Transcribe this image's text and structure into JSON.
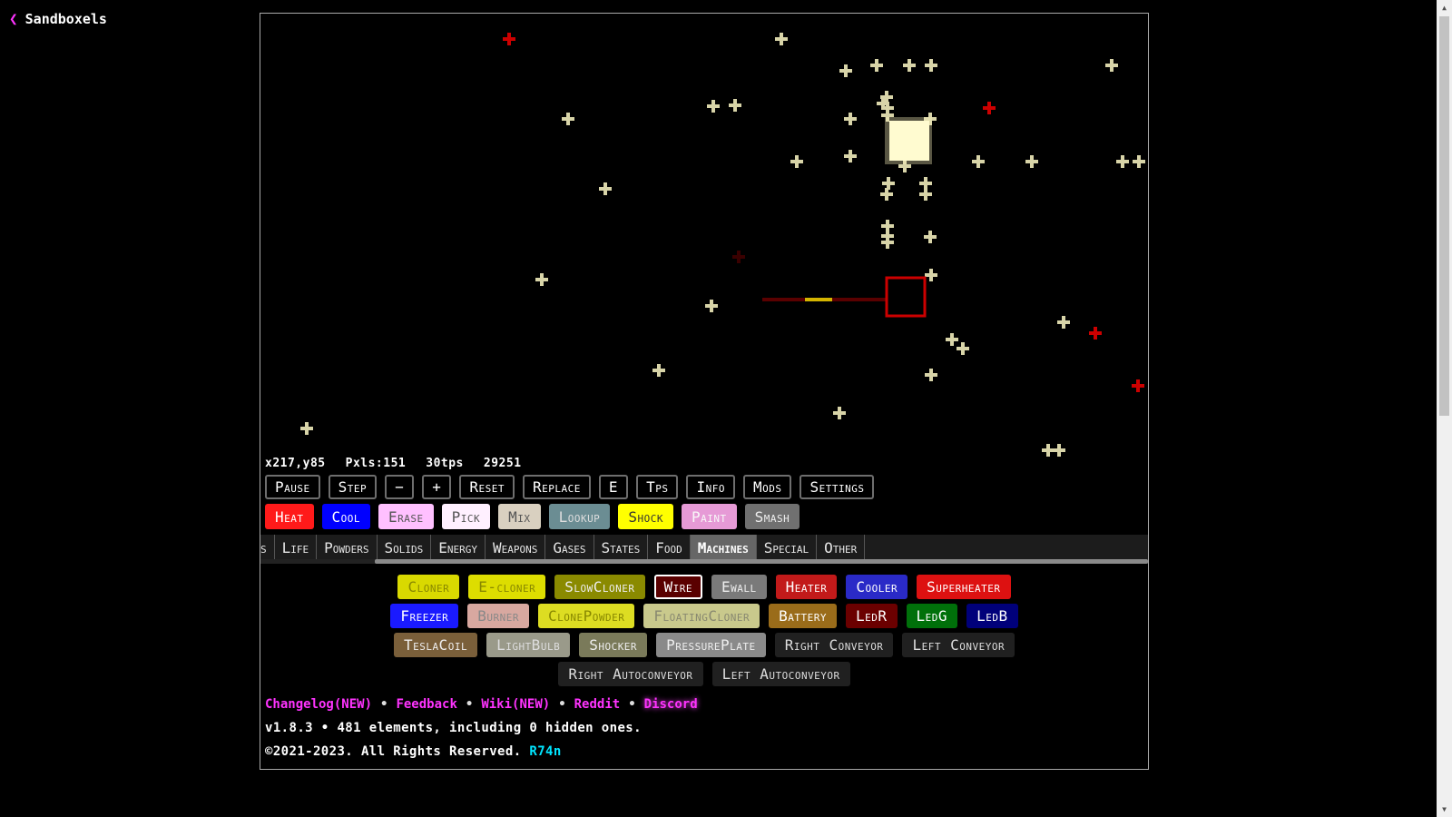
{
  "header": {
    "back_icon": "chevron-left-icon",
    "title": "Sandboxels"
  },
  "stats": {
    "coords": "x217,y85",
    "pixels": "Pxls:151",
    "tps": "30tps",
    "ticks": "29251"
  },
  "controls": [
    "Pause",
    "Step",
    "−",
    "+",
    "Reset",
    "Replace",
    "E",
    "Tps",
    "Info",
    "Mods",
    "Settings"
  ],
  "tools": [
    {
      "label": "Heat",
      "bg": "#ff1a1a",
      "fg": "#ffffff"
    },
    {
      "label": "Cool",
      "bg": "#0000ff",
      "fg": "#ffffff"
    },
    {
      "label": "Erase",
      "bg": "#ffc0ff",
      "fg": "#555555"
    },
    {
      "label": "Pick",
      "bg": "#fff0ff",
      "fg": "#555555"
    },
    {
      "label": "Mix",
      "bg": "#d9d0c0",
      "fg": "#555555"
    },
    {
      "label": "Lookup",
      "bg": "#6b8d93",
      "fg": "#dddddd"
    },
    {
      "label": "Shock",
      "bg": "#ffff00",
      "fg": "#333333"
    },
    {
      "label": "Paint",
      "bg": "#e69ad6",
      "fg": "#f8f8f8"
    },
    {
      "label": "Smash",
      "bg": "#707070",
      "fg": "#eeeeee"
    }
  ],
  "categories": {
    "items": [
      "s",
      "Life",
      "Powders",
      "Solids",
      "Energy",
      "Weapons",
      "Gases",
      "States",
      "Food",
      "Machines",
      "Special",
      "Other"
    ],
    "active": "Machines"
  },
  "elements": [
    [
      {
        "label": "Cloner",
        "bg": "#d9d900",
        "fg": "#888800"
      },
      {
        "label": "E-cloner",
        "bg": "#dddd00",
        "fg": "#888800"
      },
      {
        "label": "SlowCloner",
        "bg": "#8a8a00",
        "fg": "#eeeeee"
      },
      {
        "label": "Wire",
        "bg": "#5a0000",
        "fg": "#ffffff",
        "selected": true
      },
      {
        "label": "Ewall",
        "bg": "#7a7a7a",
        "fg": "#eeeeee"
      },
      {
        "label": "Heater",
        "bg": "#c21a1a",
        "fg": "#ffffff"
      },
      {
        "label": "Cooler",
        "bg": "#2a2ac7",
        "fg": "#ffffff"
      },
      {
        "label": "Superheater",
        "bg": "#dd1111",
        "fg": "#ffffff"
      }
    ],
    [
      {
        "label": "Freezer",
        "bg": "#1a1aff",
        "fg": "#ffffff"
      },
      {
        "label": "Burner",
        "bg": "#d8a8a0",
        "fg": "#888888"
      },
      {
        "label": "ClonePowder",
        "bg": "#dddd22",
        "fg": "#888800"
      },
      {
        "label": "FloatingCloner",
        "bg": "#c9c98c",
        "fg": "#888870"
      },
      {
        "label": "Battery",
        "bg": "#9a6c1a",
        "fg": "#ffffff"
      },
      {
        "label": "LedR",
        "bg": "#6b0000",
        "fg": "#ffffff"
      },
      {
        "label": "LedG",
        "bg": "#00700a",
        "fg": "#ffffff"
      },
      {
        "label": "LedB",
        "bg": "#00007a",
        "fg": "#ffffff"
      }
    ],
    [
      {
        "label": "TeslaCoil",
        "bg": "#7a5f3a",
        "fg": "#eeeeee"
      },
      {
        "label": "LightBulb",
        "bg": "#9a9a8a",
        "fg": "#dddddd"
      },
      {
        "label": "Shocker",
        "bg": "#7a7a5a",
        "fg": "#eeeeee"
      },
      {
        "label": "PressurePlate",
        "bg": "#8a8a8a",
        "fg": "#eeeeee"
      },
      {
        "label": "Right Conveyor",
        "bg": "#202020",
        "fg": "#dddddd"
      },
      {
        "label": "Left Conveyor",
        "bg": "#202020",
        "fg": "#dddddd"
      }
    ],
    [
      {
        "label": "Right Autoconveyor",
        "bg": "#202020",
        "fg": "#dddddd"
      },
      {
        "label": "Left Autoconveyor",
        "bg": "#202020",
        "fg": "#dddddd"
      }
    ]
  ],
  "links": {
    "changelog": "Changelog(NEW)",
    "feedback": "Feedback",
    "wiki": "Wiki(NEW)",
    "reddit": "Reddit",
    "discord": "Discord",
    "separator": "•"
  },
  "version_line": "v1.8.3 • 481 elements, including 0 hidden ones.",
  "copyright": {
    "text": "©2021-2023. All Rights Reserved.",
    "author": "R74n"
  },
  "colors": {
    "accent": "#ff33ff",
    "author": "#00e5ff",
    "particle": "#d8d4a8",
    "ember": "#cc0000",
    "wire": "#5a0000"
  }
}
